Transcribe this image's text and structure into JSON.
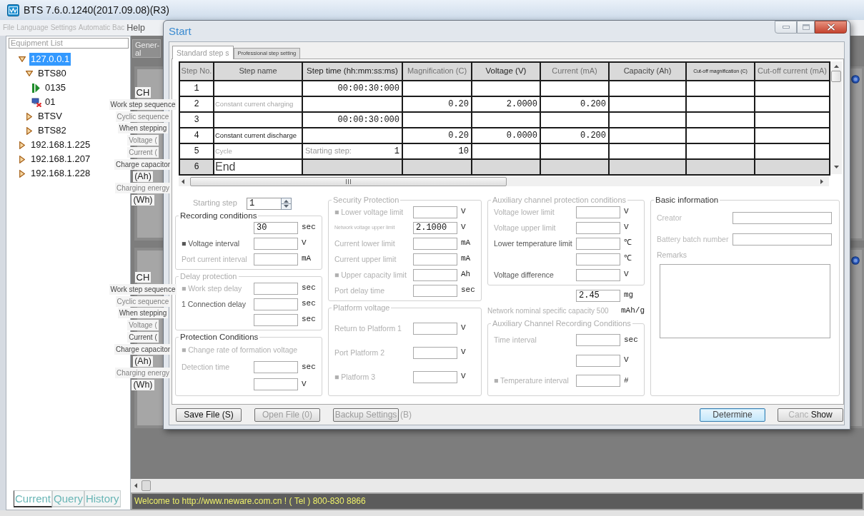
{
  "window": {
    "title": "BTS 7.6.0.1240(2017.09.08)(R3)"
  },
  "menu": [
    {
      "label": "File",
      "disabled": true
    },
    {
      "label": "Language",
      "disabled": true
    },
    {
      "label": "Settings",
      "disabled": true
    },
    {
      "label": "Automatic Bac",
      "disabled": true
    },
    {
      "label": "Help",
      "disabled": false
    }
  ],
  "equipment_panel": {
    "title": "Equipment List",
    "tree": [
      {
        "label": "127.0.0.1",
        "kind": "group",
        "expanded": true,
        "selected": true,
        "children": [
          {
            "label": "BTS80",
            "kind": "group",
            "expanded": true,
            "selected": false,
            "children": [
              {
                "label": "0135",
                "kind": "running",
                "selected": false
              },
              {
                "label": "01",
                "kind": "offline",
                "selected": false
              }
            ]
          },
          {
            "label": "BTSV",
            "kind": "group",
            "expanded": false,
            "selected": false
          },
          {
            "label": "BTS82",
            "kind": "group",
            "expanded": false,
            "selected": false
          }
        ]
      },
      {
        "label": "192.168.1.225",
        "kind": "group",
        "expanded": false,
        "selected": false
      },
      {
        "label": "192.168.1.207",
        "kind": "group",
        "expanded": false,
        "selected": false
      },
      {
        "label": "192.168.1.228",
        "kind": "group",
        "expanded": false,
        "selected": false
      }
    ],
    "tabs": [
      {
        "label": "Current",
        "selected": true
      },
      {
        "label": "Query",
        "selected": false
      },
      {
        "label": "History",
        "selected": false
      }
    ]
  },
  "workspace": {
    "tab": "Gener-al",
    "channel_panels": [
      {
        "labels": [
          {
            "text": "CH",
            "kind": "heading",
            "disabled": false
          },
          {
            "text": "Work step sequence",
            "kind": "label",
            "disabled": false
          },
          {
            "text": "Cyclic sequence",
            "kind": "label",
            "disabled": true
          },
          {
            "text": "When stepping",
            "kind": "label",
            "disabled": false
          },
          {
            "text": "Voltage (",
            "kind": "label",
            "disabled": true
          },
          {
            "text": "Current (",
            "kind": "label",
            "disabled": true
          },
          {
            "text": "Charge capacitor",
            "kind": "label",
            "disabled": false
          },
          {
            "text": "(Ah)",
            "kind": "unit",
            "disabled": false
          },
          {
            "text": "Charging energy",
            "kind": "label",
            "disabled": true
          },
          {
            "text": "(Wh)",
            "kind": "unit",
            "disabled": false
          }
        ]
      },
      {
        "labels": [
          {
            "text": "CH",
            "kind": "heading",
            "disabled": false
          },
          {
            "text": "Work step sequence",
            "kind": "label",
            "disabled": false
          },
          {
            "text": "Cyclic sequence",
            "kind": "label",
            "disabled": true
          },
          {
            "text": "When stepping",
            "kind": "label",
            "disabled": false
          },
          {
            "text": "Voltage (",
            "kind": "label",
            "disabled": true
          },
          {
            "text": "Current (",
            "kind": "label",
            "disabled": false
          },
          {
            "text": "Charge capacitor",
            "kind": "label",
            "disabled": false
          },
          {
            "text": "(Ah)",
            "kind": "unit",
            "disabled": false
          },
          {
            "text": "Charging energy",
            "kind": "label",
            "disabled": true
          },
          {
            "text": "(Wh)",
            "kind": "unit",
            "disabled": false
          }
        ]
      }
    ]
  },
  "status_bar": {
    "text": "Welcome to http://www.neware.com.cn ! ( Tel ) 800-830 8866"
  },
  "dialog": {
    "title": "Start",
    "tabs": [
      {
        "label": "Standard step s",
        "selected": true
      },
      {
        "label": "Professional step setting",
        "selected": false
      }
    ],
    "table": {
      "columns": [
        {
          "label": "Step No.",
          "disabled": true
        },
        {
          "label": "Step name",
          "disabled": false
        },
        {
          "label": "Step time (hh:mm:ss:ms)",
          "disabled": false
        },
        {
          "label": "Magnification (C)",
          "disabled": true
        },
        {
          "label": "Voltage (V)",
          "disabled": false
        },
        {
          "label": "Current (mA)",
          "disabled": true
        },
        {
          "label": "Capacity (Ah)",
          "disabled": false
        },
        {
          "label": "Cut-off magnification (C)",
          "disabled": false
        },
        {
          "label": "Cut-off current (mA)",
          "disabled": true
        }
      ],
      "rows": [
        {
          "kind": "step",
          "no": "1",
          "time": "00:00:30:000"
        },
        {
          "kind": "step",
          "no": "2",
          "name": {
            "text": "Constant current charging",
            "disabled": true
          },
          "magnification": "0.20",
          "voltage": "2.0000",
          "current": "0.200"
        },
        {
          "kind": "step",
          "no": "3",
          "time": "00:00:30:000"
        },
        {
          "kind": "step",
          "no": "4",
          "name": {
            "text": "Constant current discharge",
            "disabled": false
          },
          "magnification": "0.20",
          "voltage": "0.0000",
          "current": "0.200"
        },
        {
          "kind": "cycle",
          "no": "5",
          "name": {
            "text": "Cycle",
            "disabled": true
          },
          "start_label": "Starting step:",
          "time": "1",
          "magnification": "10"
        },
        {
          "kind": "end",
          "no": "6",
          "name": {
            "text": "End",
            "disabled": false
          }
        }
      ]
    },
    "settings": [
      [
        {
          "kind": "spin",
          "label": "Starting step",
          "disabled": true,
          "value": "1"
        },
        {
          "kind": "group",
          "title": "Recording conditions",
          "disabled": false,
          "rows": [
            {
              "kind": "field",
              "value": "30",
              "unit": "sec"
            },
            {
              "kind": "field",
              "label": "■ Voltage interval",
              "disabled": false,
              "unit": "V"
            },
            {
              "kind": "field",
              "label": "Port current interval",
              "disabled": true,
              "unit": "mA"
            }
          ]
        },
        {
          "kind": "group",
          "title": "Delay protection",
          "disabled": true,
          "rows": [
            {
              "kind": "field",
              "label": "■ Work step delay",
              "disabled": true,
              "unit": "sec"
            },
            {
              "kind": "field",
              "label": "1 Connection delay",
              "disabled": false,
              "unit": "sec"
            },
            {
              "kind": "field",
              "unit": "sec"
            }
          ]
        },
        {
          "kind": "group",
          "title": "Protection Conditions",
          "disabled": false,
          "rows": [
            {
              "kind": "note",
              "label": "■ Change rate of formation voltage",
              "disabled": true
            },
            {
              "kind": "field",
              "label": "Detection time",
              "disabled": true,
              "unit": "sec"
            },
            {
              "kind": "field",
              "unit": "V"
            }
          ]
        }
      ],
      [
        {
          "kind": "group",
          "title": "Security Protection",
          "disabled": true,
          "rows": [
            {
              "kind": "field",
              "label": "■ Lower voltage limit",
              "disabled": true,
              "unit": "V"
            },
            {
              "kind": "compact",
              "label": "Network voltage upper limit",
              "disabled": true,
              "value": "2.1000",
              "unit": "V"
            },
            {
              "kind": "field",
              "label": "Current lower limit",
              "disabled": true,
              "unit": "mA"
            },
            {
              "kind": "field",
              "label": "Current upper limit",
              "disabled": true,
              "unit": "mA"
            },
            {
              "kind": "field",
              "label": "■ Upper capacity limit",
              "disabled": true,
              "unit": "Ah"
            },
            {
              "kind": "field",
              "label": "Port delay time",
              "disabled": true,
              "unit": "sec"
            }
          ]
        },
        {
          "kind": "group",
          "title": "Platform voltage",
          "disabled": true,
          "rows": [
            {
              "kind": "field",
              "label": "Return to Platform 1",
              "disabled": true,
              "unit": "V"
            },
            {
              "kind": "field",
              "label": "Port Platform 2",
              "disabled": true,
              "unit": "V"
            },
            {
              "kind": "field",
              "label": "■ Platform 3",
              "disabled": true,
              "unit": "V"
            }
          ]
        }
      ],
      [
        {
          "kind": "group",
          "title": "Auxiliary channel protection conditions",
          "disabled": true,
          "rows": [
            {
              "kind": "field",
              "label": "Voltage lower limit",
              "disabled": true,
              "unit": "V"
            },
            {
              "kind": "field",
              "label": "Voltage upper limit",
              "disabled": true,
              "unit": "V"
            },
            {
              "kind": "field",
              "label": "Lower temperature limit",
              "disabled": false,
              "unit": "℃"
            },
            {
              "kind": "field",
              "unit": "℃"
            },
            {
              "kind": "field",
              "label": "Voltage difference",
              "disabled": false,
              "unit": "V"
            }
          ]
        },
        {
          "kind": "field",
          "value": "2.45",
          "unit": "mg"
        },
        {
          "kind": "note",
          "label": "Network nominal specific capacity 500",
          "disabled": true,
          "unit": "mAh/g"
        },
        {
          "kind": "group",
          "title": "Auxiliary Channel Recording Conditions",
          "disabled": true,
          "rows": [
            {
              "kind": "field",
              "label": "Time interval",
              "disabled": true,
              "unit": "sec"
            },
            {
              "kind": "field",
              "unit": "V"
            },
            {
              "kind": "field",
              "label": "■ Temperature interval",
              "disabled": true,
              "unit": "#"
            }
          ]
        }
      ],
      [
        {
          "kind": "group",
          "title": "Basic information",
          "disabled": false,
          "rows": [
            {
              "kind": "wide",
              "label": "Creator",
              "disabled": true
            },
            {
              "kind": "wide",
              "label": "Battery batch number",
              "disabled": true
            },
            {
              "kind": "note",
              "label": "Remarks",
              "disabled": true
            },
            {
              "kind": "textarea"
            }
          ]
        }
      ]
    ],
    "file_buttons": [
      {
        "label": "Save File (S)",
        "disabled": false
      },
      {
        "label": "Open File (0)",
        "disabled": true
      },
      {
        "label": "Backup Settings",
        "disabled": true,
        "shortcut": "(B)"
      }
    ],
    "dialog_buttons": [
      {
        "label": "Determine",
        "disabled": false,
        "focused": true
      },
      {
        "label": "Canc",
        "disabled": true,
        "focused": false,
        "overlay": "Show"
      }
    ]
  }
}
